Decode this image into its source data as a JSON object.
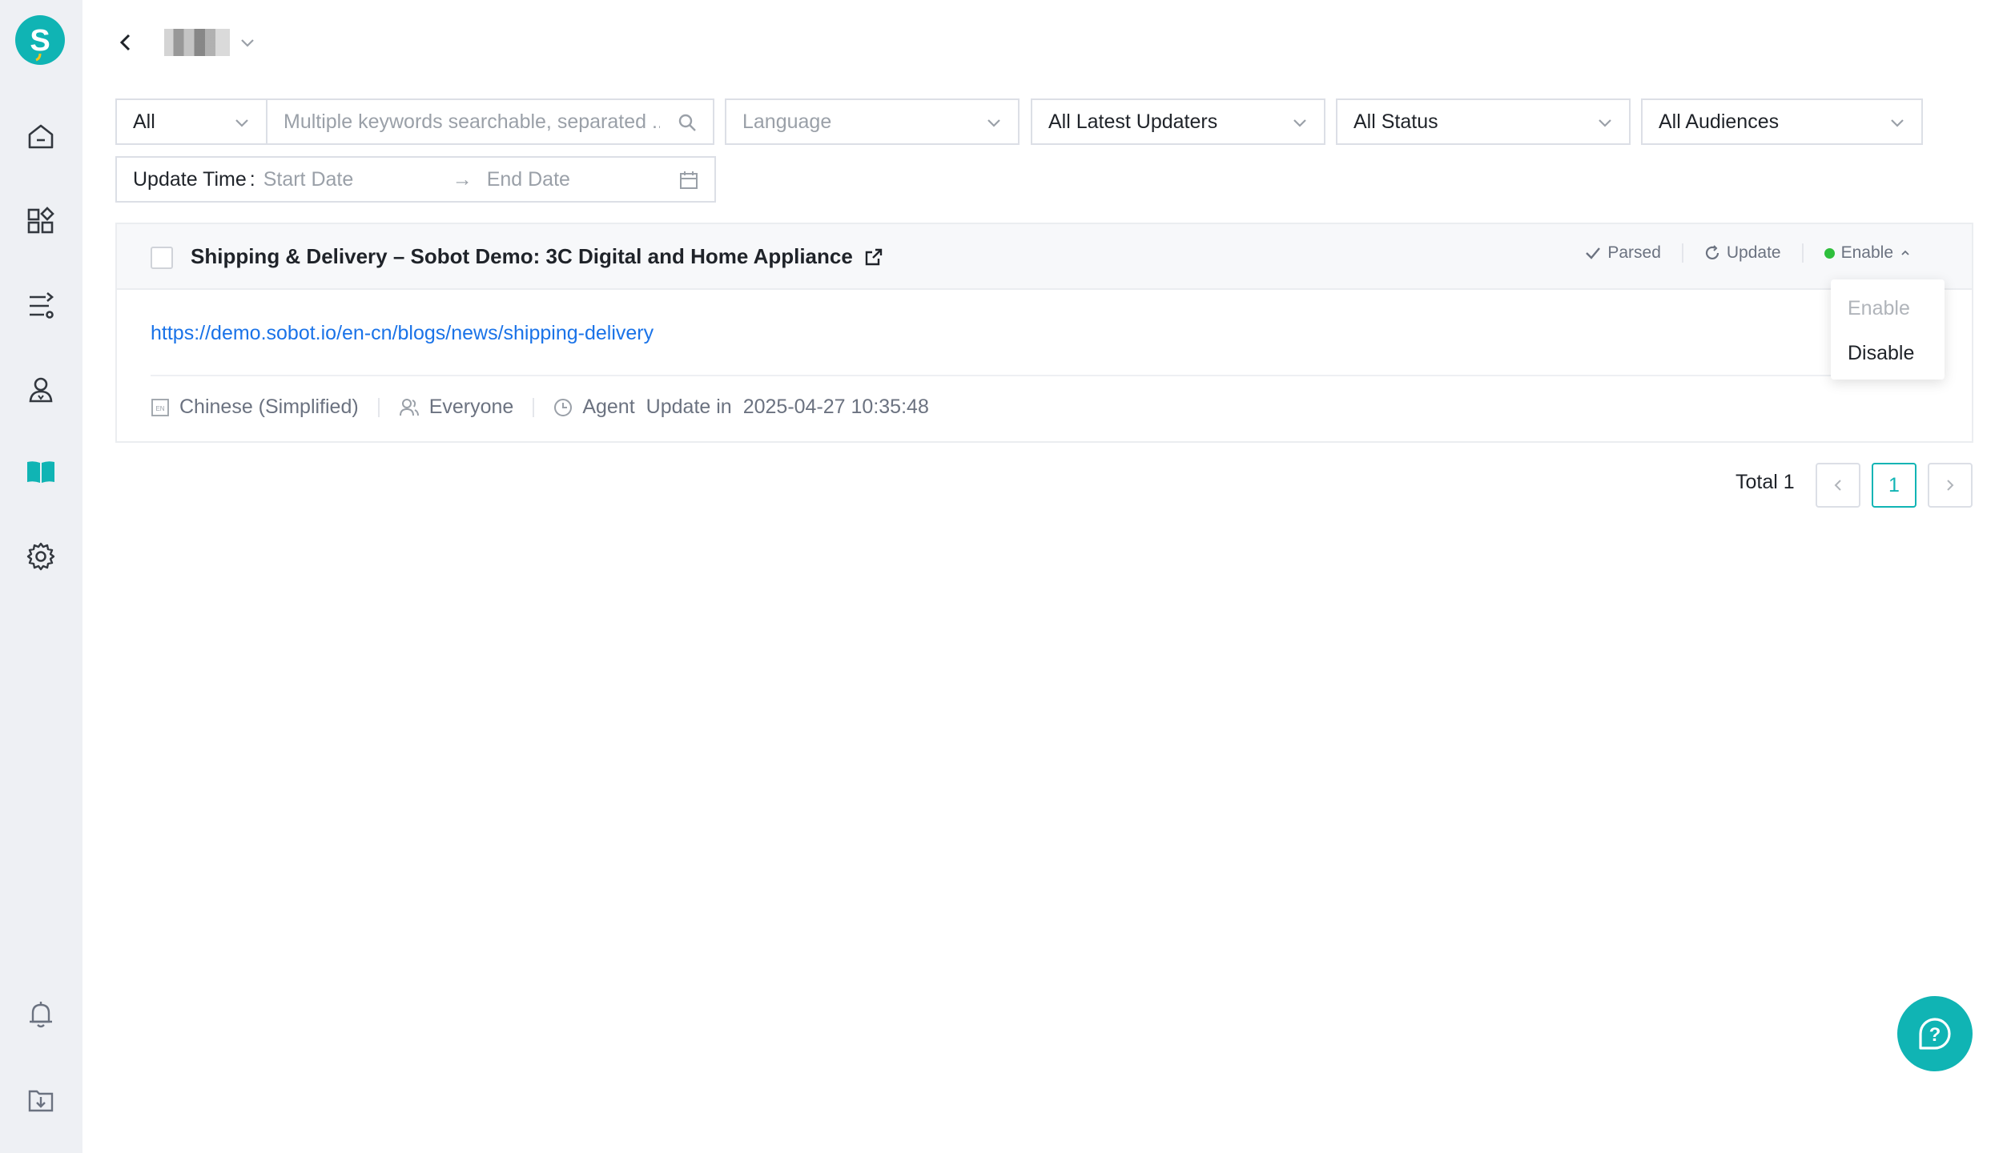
{
  "sidebar": {
    "logo_letter": "S",
    "accent": "#10b4b4",
    "icons": [
      "home-icon",
      "apps-icon",
      "flow-icon",
      "user-icon",
      "book-icon",
      "gear-icon",
      "bell-icon",
      "download-icon"
    ]
  },
  "header": {
    "back_icon": "chevron-left-icon",
    "project_name_redacted": "pixelated"
  },
  "filters": {
    "scope": "All",
    "search_placeholder": "Multiple keywords searchable, separated ...",
    "language_placeholder": "Language",
    "updaters": "All Latest Updaters",
    "status": "All Status",
    "audiences": "All Audiences",
    "update_time_label": "Update Time",
    "start_placeholder": "Start Date",
    "end_placeholder": "End Date"
  },
  "item": {
    "title": "Shipping & Delivery – Sobot Demo: 3C Digital and Home Appliance",
    "parsed_label": "Parsed",
    "update_label": "Update",
    "status_label": "Enable",
    "status_color": "#2ebf3c",
    "url": "https://demo.sobot.io/en-cn/blogs/news/shipping-delivery",
    "language": "Chinese (Simplified)",
    "audience": "Everyone",
    "updater": "Agent",
    "update_prefix": "Update in",
    "updated_at": "2025-04-27 10:35:48"
  },
  "status_menu": {
    "options": [
      "Enable",
      "Disable"
    ],
    "selected": "Enable"
  },
  "pagination": {
    "total_label": "Total 1",
    "current_page": "1"
  }
}
